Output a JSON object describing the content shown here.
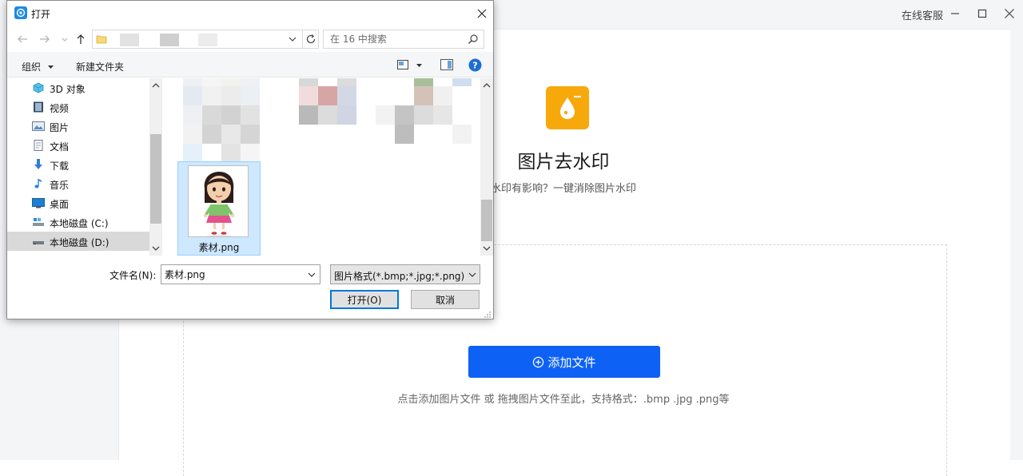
{
  "app": {
    "service_label": "在线客服",
    "title": "图片去水印",
    "subtitle": "水印有影响？一键消除图片水印",
    "add_button_label": "添加文件",
    "hint": "点击添加图片文件 或 拖拽图片文件至此，支持格式：.bmp .jpg .png等",
    "brand_color": "#0d62f5",
    "logo_color": "#f7a80b",
    "icons": [
      "minimize-icon",
      "maximize-icon",
      "close-icon",
      "water-drop-icon",
      "plus-circle-icon"
    ]
  },
  "dialog": {
    "title": "打开",
    "search_placeholder": "在 16 中搜索",
    "toolbar": {
      "organize_label": "组织",
      "new_folder_label": "新建文件夹"
    },
    "tree": [
      {
        "label": "3D 对象",
        "icon": "3d-objects-icon"
      },
      {
        "label": "视频",
        "icon": "video-icon"
      },
      {
        "label": "图片",
        "icon": "pictures-icon"
      },
      {
        "label": "文档",
        "icon": "documents-icon"
      },
      {
        "label": "下载",
        "icon": "download-icon"
      },
      {
        "label": "音乐",
        "icon": "music-icon"
      },
      {
        "label": "桌面",
        "icon": "desktop-icon"
      },
      {
        "label": "本地磁盘 (C:)",
        "icon": "drive-c-icon"
      },
      {
        "label": "本地磁盘 (D:)",
        "icon": "drive-d-icon",
        "selected": true
      }
    ],
    "selected_file": {
      "name": "素材.png"
    },
    "filename_label": "文件名(N):",
    "filename_value": "素材.png",
    "filetype_value": "图片格式(*.bmp;*.jpg;*.png)",
    "open_label": "打开(O)",
    "cancel_label": "取消",
    "selection_color": "#cde8ff"
  }
}
